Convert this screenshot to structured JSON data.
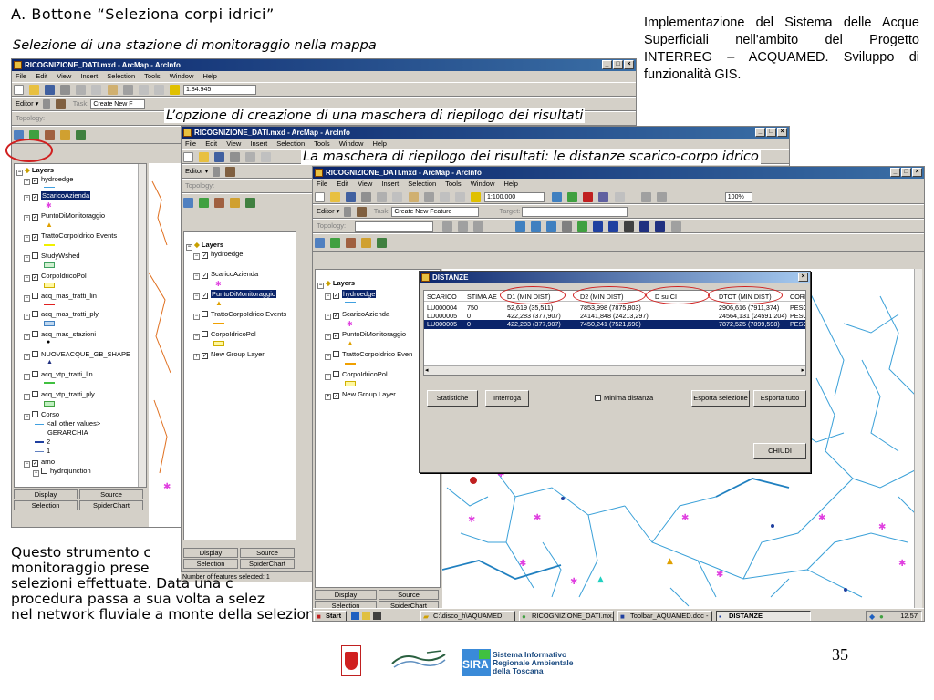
{
  "slide": {
    "heading": "A. Bottone “Seleziona corpi idrici”",
    "caption1": "Selezione di una stazione di monitoraggio nella mappa",
    "caption2": "L’opzione di creazione di una maschera di riepilogo dei risultati",
    "caption3": "La maschera di riepilogo dei risultati: le distanze scarico-corpo idrico",
    "side_text": "Implementazione del Sistema delle Acque Superficiali nell'ambito del Progetto INTERREG – ACQUAMED. Sviluppo di funzionalità GIS.",
    "body_lines": [
      "Questo strumento c",
      "monitoraggio prese",
      "selezioni effettuate. Data una c",
      "procedura passa a sua volta a selez",
      "nel network fluviale a monte della selezione stessa."
    ],
    "page_number": "35",
    "footer_logo_text": "Sistema Informativo Regionale Ambientale della Toscana",
    "footer_logo_sira": "SIRA"
  },
  "window1": {
    "title": "RICOGNIZIONE_DATI.mxd - ArcMap - ArcInfo",
    "menu": [
      "File",
      "Edit",
      "View",
      "Insert",
      "Selection",
      "Tools",
      "Window",
      "Help"
    ],
    "scale": "1:84.945",
    "editor_label": "Editor ▾",
    "task_label": "Task:",
    "task_value": "Create New F",
    "topology_label": "Topology:",
    "layers_root": "Layers",
    "layers": [
      "hydroedge",
      "ScaricoAzienda",
      "PuntoDiMonitoraggio",
      "TrattoCorpoIdrico Events",
      "StudyWshed",
      "CorpoIdricoPol",
      "acq_mas_tratti_lin",
      "acq_mas_tratti_ply",
      "acq_mas_stazioni",
      "NUOVEACQUE_GB_SHAPE",
      "acq_vtp_tratti_lin",
      "acq_vtp_tratti_ply",
      "Corso",
      "<all other values>",
      "GERARCHIA",
      "2",
      "1",
      "arno",
      "hydrojunction"
    ],
    "tabs": [
      "Display",
      "Source",
      "Selection",
      "SpiderChart"
    ]
  },
  "window2": {
    "title": "RICOGNIZIONE_DATI.mxd - ArcMap - ArcInfo",
    "menu": [
      "File",
      "Edit",
      "View",
      "Insert",
      "Selection",
      "Tools",
      "Window",
      "Help"
    ],
    "editor_label": "Editor ▾",
    "topology_label": "Topology:",
    "layers_root": "Layers",
    "layers": [
      "hydroedge",
      "ScaricoAzienda",
      "PuntoDiMonitoraggio",
      "TrattoCorpoIdrico Events",
      "CorpoIdricoPol",
      "New Group Layer"
    ],
    "tabs": [
      "Display",
      "Source",
      "Selection",
      "SpiderChart"
    ],
    "status": "Number of features selected: 1"
  },
  "window3": {
    "title": "RICOGNIZIONE_DATI.mxd - ArcMap - ArcInfo",
    "menu": [
      "File",
      "Edit",
      "View",
      "Insert",
      "Selection",
      "Tools",
      "Window",
      "Help"
    ],
    "scale": "1:100.000",
    "zoom": "100%",
    "editor_label": "Editor ▾",
    "task_label": "Task:",
    "task_value": "Create New Feature",
    "target_label": "Target:",
    "topology_label": "Topology:",
    "layers_root": "Layers",
    "layers": [
      "hydroedge",
      "ScaricoAzienda",
      "PuntoDiMonitoraggio",
      "TrattoCorpoIdrico Even",
      "CorpoIdricoPol",
      "New Group Layer"
    ],
    "tabs": [
      "Display",
      "Source",
      "Selection",
      "SpiderChart"
    ]
  },
  "dialog": {
    "title": "DISTANZE",
    "columns": [
      "SCARICO",
      "STIMA AE",
      "D1 (MIN DIST)",
      "D2 (MIN DIST)",
      "D su CI",
      "DTOT (MIN DIST)",
      "CORP"
    ],
    "rows": [
      [
        "LU000004",
        "750",
        "52,619 (35,511)",
        "7853,998 (7875,803)",
        "",
        "2906,616 (7911,374)",
        "PESC"
      ],
      [
        "LU000005",
        "0",
        "422,283 (377,907)",
        "24141,848 (24213,297)",
        "",
        "24564,131 (24591,204)",
        "PESC"
      ],
      [
        "LU000005",
        "0",
        "422,283 (377,907)",
        "7450,241 (7521,690)",
        "",
        "7872,525 (7899,598)",
        "PESC"
      ]
    ],
    "btn_statistiche": "Statistiche",
    "btn_interroga": "Interroga",
    "chk_minima": "Minima distanza",
    "btn_esporta_sel": "Esporta selezione",
    "btn_esporta_tutto": "Esporta tutto",
    "btn_chiudi": "CHIUDI"
  },
  "taskbar": {
    "start": "Start",
    "tasks": [
      "C:\\disco_h\\AQUAMED",
      "RICOGNIZIONE_DATI.mx...",
      "Toolbar_AQUAMED.doc - ...",
      "DISTANZE"
    ],
    "clock": "12.57"
  }
}
